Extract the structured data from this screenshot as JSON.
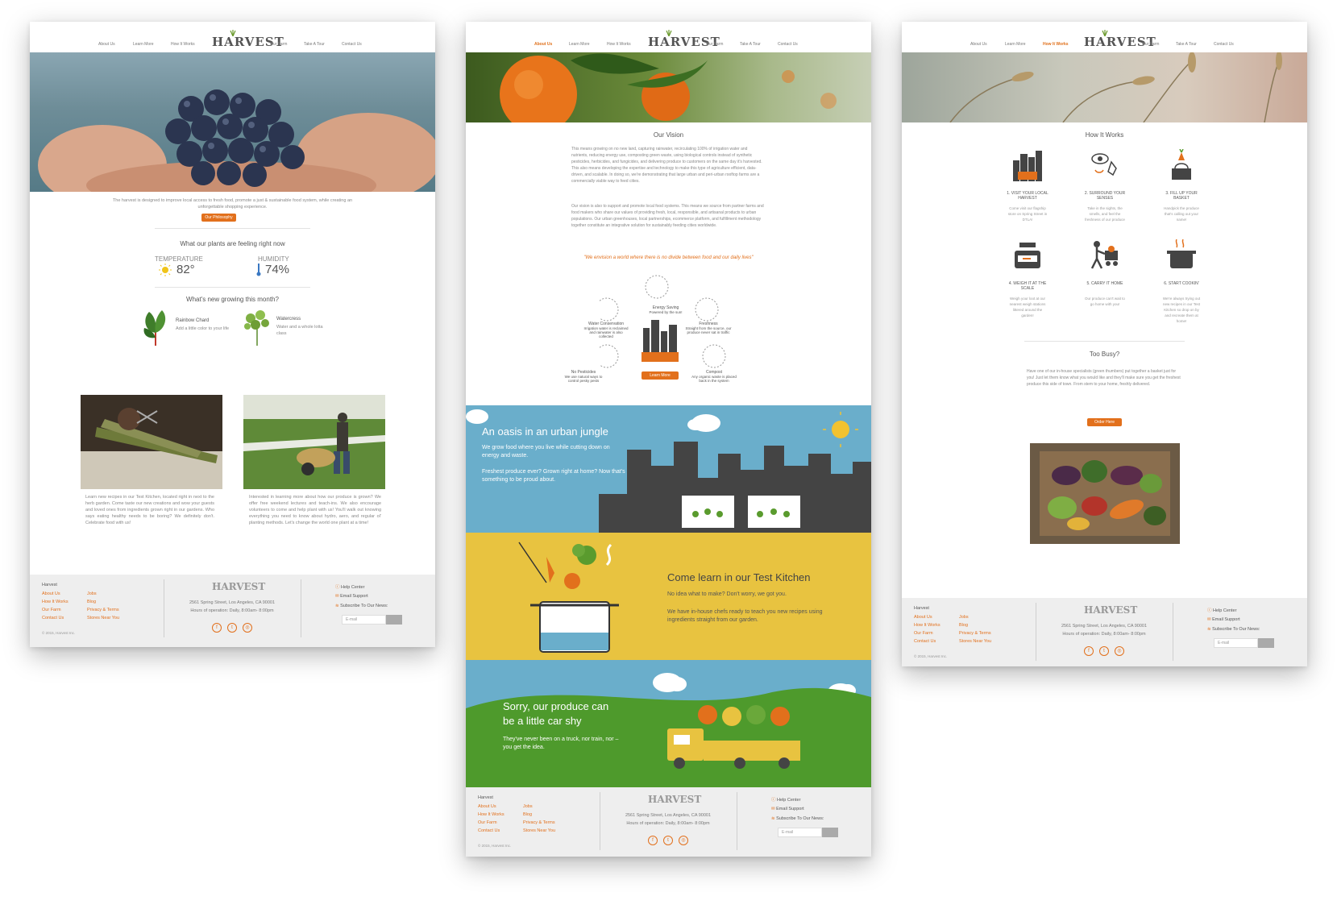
{
  "nav": {
    "about": "About Us",
    "learn": "Learn More",
    "how": "How It Works",
    "farm": "Our Farm",
    "tour": "Take A Tour",
    "contact": "Contact Us",
    "logo": "HARVEST"
  },
  "home": {
    "intro": "The harvest is designed to improve local access to fresh food, promote a just & sustainable food system, while creating an unforgettable shopping experience.",
    "philosophy_btn": "Our Philosophy",
    "plants_title": "What our plants are feeling right now",
    "temp_label": "TEMPERATURE",
    "temp_value": "82°",
    "humidity_label": "HUMIDITY",
    "humidity_value": "74%",
    "growing_title": "What's new growing this month?",
    "plant1_name": "Rainbow Chard",
    "plant1_desc": "Add a little color to your life",
    "plant2_name": "Watercress",
    "plant2_desc": "Water and a whole lotta class",
    "col1_text": "Learn new recipes in our Test Kitchen, located right in next to the herb garden. Come taste our new creations and wow your guests and loved ones from ingredients grown right in our gardens. Who says eating healthy needs to be boring? We definitely don't. Celebrate food with us!",
    "col2_text": "Interested in learning more about how our produce is grown? We offer free weekend lectures and teach-ins. We also encourage volunteers to come and help plant with us! You'll walk out knowing everything you need to know about hydro, aero, and regular ol' planting methods. Let's change the world one plant at a time!"
  },
  "about": {
    "vision_title": "Our Vision",
    "vision_p1": "This means growing on no new land, capturing rainwater, recirculating 100% of irrigation water and nutrients, reducing energy use, composting green waste, using biological controls instead of synthetic pesticides, herbicides, and fungicides, and delivering produce to customers on the same day it's harvested. This also means developing the expertise and technology to make this type of agriculture efficient, data-driven, and scalable. In doing so, we're demonstrating that large urban and peri-urban rooftop farms are a commercially viable way to feed cities.",
    "vision_p2": "Our vision is also to support and promote local food systems. This means we source from partner farms and food makers who share our values of providing fresh, local, responsible, and artisanal products to urban populations. Our urban greenhouses, local partnerships, ecommerce platform, and fulfillment methodology together constitute an integrative solution for sustainably feeding cities worldwide.",
    "quote": "\"We envision a world where there is no divide between food and our daily lives\"",
    "f_energy_t": "Energy Saving",
    "f_energy_d": "Powered by the sun!",
    "f_water_t": "Water Conservation",
    "f_water_d": "Irrigation water is reclaimed and rainwater is also collected",
    "f_fresh_t": "Freshness",
    "f_fresh_d": "Straight from the source, our produce never sat in traffic",
    "f_pest_t": "No Pesticides",
    "f_pest_d": "We use natural ways to control pesky pests",
    "f_compost_t": "Compost",
    "f_compost_d": "Any organic waste is placed back in the system",
    "learn_btn": "Learn More",
    "band1_title": "An oasis in an urban jungle",
    "band1_p1": "We grow food where you live while cutting down on energy and waste.",
    "band1_p2": "Freshest produce ever? Grown right at home? Now that's something to be proud about.",
    "band2_title": "Come learn in our Test Kitchen",
    "band2_p1": "No idea what to make? Don't worry, we got you.",
    "band2_p2": "We have in-house chefs ready to teach you new recipes using ingredients straight from our garden.",
    "band3_title1": "Sorry, our produce can",
    "band3_title2": "be a little car shy",
    "band3_p": "They've never been on a truck, nor train, nor – you get the idea."
  },
  "how": {
    "title": "How It Works",
    "s1_t": "1. VISIT YOUR LOCAL HARVEST",
    "s1_d": "Come visit our flagship store on Spring Street in DTLA!",
    "s2_t": "2. SURROUND YOUR SENSES",
    "s2_d": "Take in the sights, the smells, and feel the freshness of our produce",
    "s3_t": "3. FILL UP YOUR BASKET",
    "s3_d": "Handpick the produce that's calling out your name!",
    "s4_t": "4. WEIGH IT AT THE SCALE",
    "s4_d": "Weigh your loot at our nearest weigh stations littered around the garden!",
    "s5_t": "5. CARRY IT HOME",
    "s5_d": "Our produce can't wait to go home with you!",
    "s6_t": "6. START COOKIN'",
    "s6_d": "We're always trying out new recipes in our Test Kitchen so drop on by and recreate them at home!",
    "busy_title": "Too Busy?",
    "busy_p": "Have one of our in-house specialists (green thumbers) put together a basket just for you! Just let them know what you would like and they'll make sure you get the freshest produce this side of town. From stem to your home, freshly delivered.",
    "order_btn": "Order Here"
  },
  "footer": {
    "brand": "Harvest",
    "l1": "About Us",
    "l2": "How It Works",
    "l3": "Our Farm",
    "l4": "Contact Us",
    "r1": "Jobs",
    "r2": "Blog",
    "r3": "Privacy & Terms",
    "r4": "Stores Near You",
    "address": "2561 Spring Street, Los Angeles, CA 90001",
    "hours": "Hours of operation: Daily, 8:00am- 8:00pm",
    "help": "Help Center",
    "support": "Email Support",
    "subscribe": "Subscribe To Our News:",
    "email_placeholder": "E-mail",
    "copyright": "© 2015, Harvest Inc."
  },
  "colors": {
    "accent": "#e2701c",
    "sky": "#6aaecb",
    "kitchen": "#e8c340",
    "grass": "#4e9a2c",
    "footer": "#eeeeee"
  }
}
